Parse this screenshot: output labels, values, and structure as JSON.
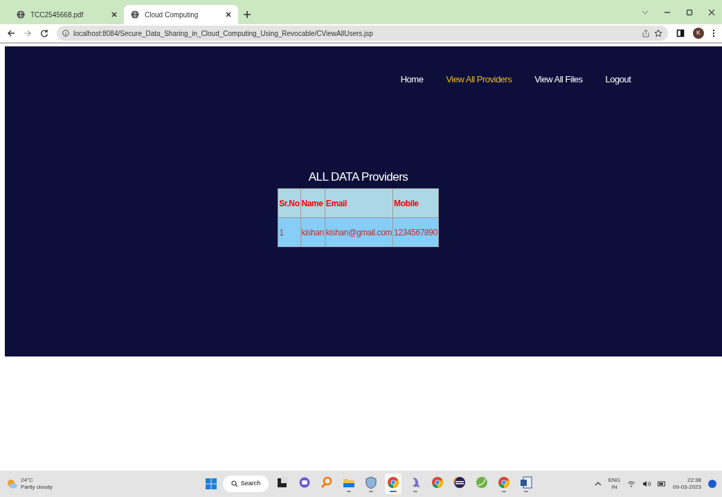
{
  "browser": {
    "tabs": [
      {
        "title": "TCC2545668.pdf",
        "selected": false
      },
      {
        "title": "Cloud Computing",
        "selected": true
      }
    ],
    "address": "localhost:8084/Secure_Data_Sharing_in_Cloud_Computing_Using_Revocable/CViewAllUsers.jsp",
    "profile": "K"
  },
  "nav": [
    {
      "label": "Home",
      "selected": false
    },
    {
      "label": "View All Providers",
      "selected": true
    },
    {
      "label": "View All Files",
      "selected": false
    },
    {
      "label": "Logout",
      "selected": false
    }
  ],
  "heading": "ALL DATA Providers",
  "table": {
    "columns": [
      "Sr.No",
      "Name",
      "Email",
      "Mobile"
    ],
    "rows": [
      [
        "1",
        "kishan",
        "kishan@gmail.com",
        "1234567890"
      ]
    ]
  },
  "taskbar": {
    "weather": {
      "temperature": "24°C",
      "condition": "Partly cloudy"
    },
    "search": "Search",
    "apps": [
      {
        "kind": "widgets",
        "running": false,
        "active": false
      },
      {
        "kind": "chat",
        "running": false,
        "active": false
      },
      {
        "kind": "magnifier",
        "running": false,
        "active": false
      },
      {
        "kind": "folder",
        "running": true,
        "active": false
      },
      {
        "kind": "shield",
        "running": true,
        "active": false
      },
      {
        "kind": "chrome",
        "running": true,
        "active": true
      },
      {
        "kind": "dolphin",
        "running": true,
        "active": false
      },
      {
        "kind": "chrome",
        "running": false,
        "active": false
      },
      {
        "kind": "eclipse",
        "running": false,
        "active": false
      },
      {
        "kind": "leaf",
        "running": false,
        "active": false
      },
      {
        "kind": "chrome",
        "running": true,
        "active": false
      },
      {
        "kind": "word",
        "running": true,
        "active": false
      }
    ],
    "language": "ENG",
    "region": "IN",
    "time": "22:38",
    "date": "09-03-2023"
  }
}
